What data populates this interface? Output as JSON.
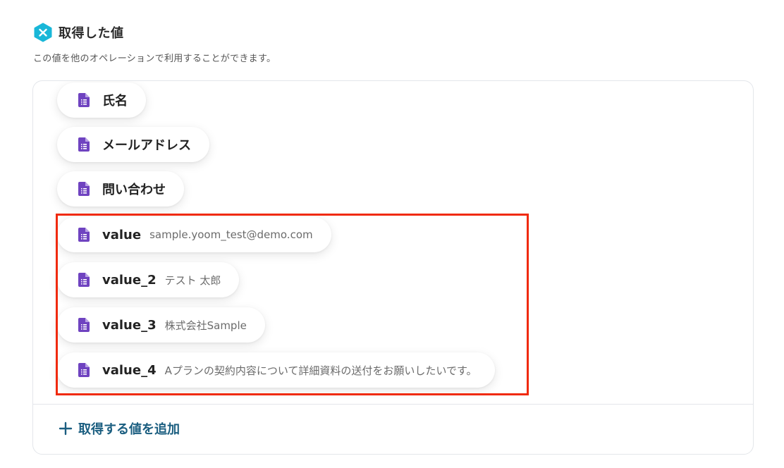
{
  "section": {
    "title": "取得した値",
    "description": "この値を他のオペレーションで利用することができます。",
    "logo_icon": "yoom-logo-icon",
    "logo_color": "#19b7d8"
  },
  "values": [
    {
      "label": "氏名",
      "value": "",
      "icon": "document-icon"
    },
    {
      "label": "メールアドレス",
      "value": "",
      "icon": "document-icon"
    },
    {
      "label": "問い合わせ",
      "value": "",
      "icon": "document-icon"
    },
    {
      "label": "value",
      "value": "sample.yoom_test@demo.com",
      "icon": "document-icon"
    },
    {
      "label": "value_2",
      "value": "テスト 太郎",
      "icon": "document-icon"
    },
    {
      "label": "value_3",
      "value": "株式会社Sample",
      "icon": "document-icon"
    },
    {
      "label": "value_4",
      "value": "Aプランの契約内容について詳細資料の送付をお願いしたいです。",
      "icon": "document-icon"
    }
  ],
  "add_button": {
    "label": "取得する値を追加",
    "icon": "plus-icon"
  },
  "colors": {
    "doc_icon": "#6f43c0",
    "highlight": "#f02a0c",
    "accent_text": "#1b5e80"
  }
}
